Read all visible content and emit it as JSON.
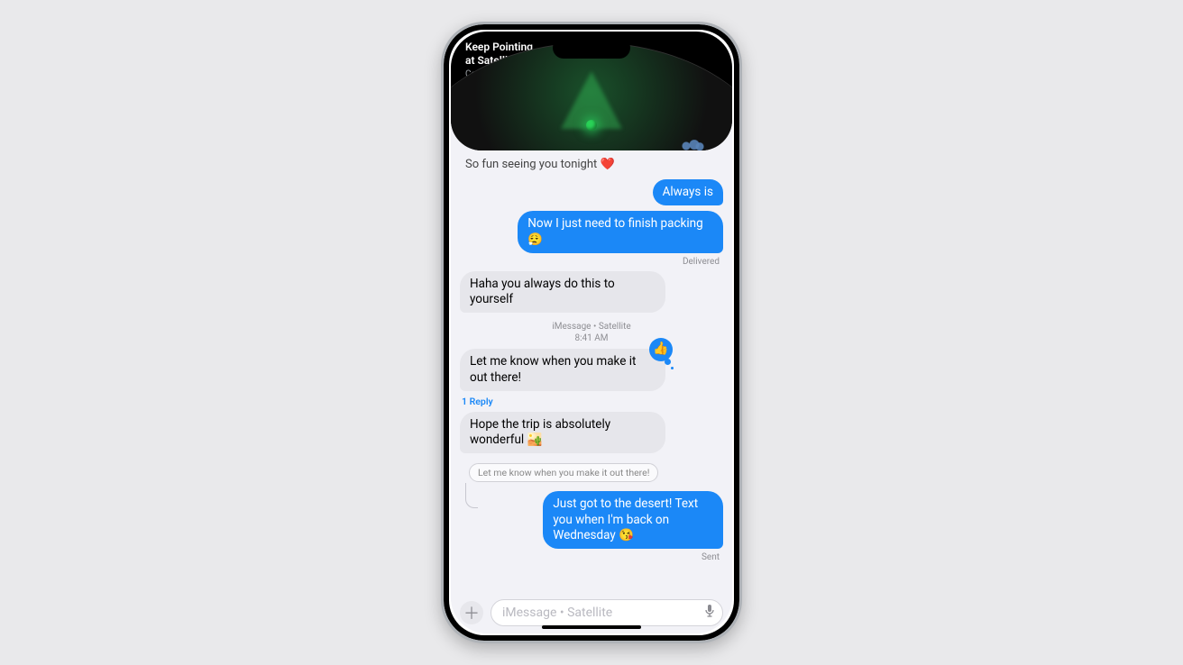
{
  "satellite": {
    "title_line1": "Keep Pointing",
    "title_line2": "at Satellite",
    "status": "Connected"
  },
  "chat": {
    "preBanner": "So fun seeing you tonight ❤️",
    "messages": [
      {
        "side": "out",
        "text": "Always is"
      },
      {
        "side": "out",
        "text": "Now I just need to finish packing 😮‍💨"
      }
    ],
    "deliveredLabel": "Delivered",
    "messages2": [
      {
        "side": "in",
        "text": "Haha you always do this to yourself"
      }
    ],
    "divider": {
      "line1": "iMessage • Satellite",
      "line2": "8:41 AM"
    },
    "messages3": [
      {
        "side": "in",
        "text": "Let me know when you make it out there!",
        "tapback": "👍"
      }
    ],
    "replyCount": "1 Reply",
    "messages4": [
      {
        "side": "in",
        "text": "Hope the trip is absolutely wonderful 🏜️"
      }
    ],
    "quotedText": "Let me know when you make it out there!",
    "replyMessage": "Just got to the desert! Text you when I'm back on Wednesday 😘",
    "sentLabel": "Sent"
  },
  "compose": {
    "placeholder": "iMessage • Satellite"
  }
}
